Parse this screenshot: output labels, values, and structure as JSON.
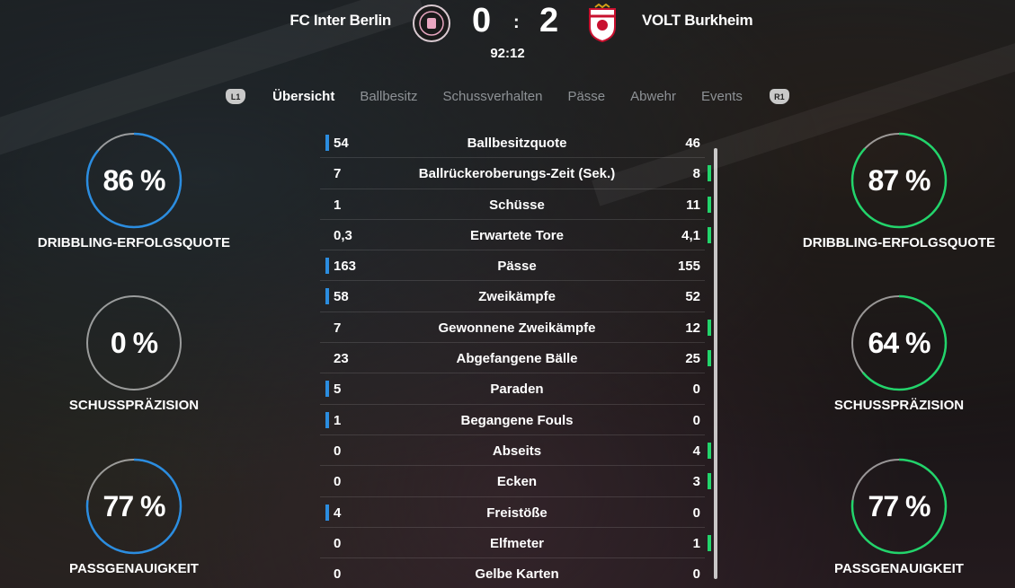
{
  "header": {
    "home_team": "FC Inter Berlin",
    "away_team": "VOLT Burkheim",
    "home_score": "0",
    "away_score": "2",
    "separator": ":",
    "clock": "92:12"
  },
  "tabs": {
    "left_bumper": "L1",
    "right_bumper": "R1",
    "items": [
      "Übersicht",
      "Ballbesitz",
      "Schussverhalten",
      "Pässe",
      "Abwehr",
      "Events"
    ],
    "active": "Übersicht"
  },
  "stats": [
    {
      "label": "Ballbesitzquote",
      "home": "54",
      "away": "46",
      "leader": "home"
    },
    {
      "label": "Ballrückeroberungs-Zeit (Sek.)",
      "home": "7",
      "away": "8",
      "leader": "away"
    },
    {
      "label": "Schüsse",
      "home": "1",
      "away": "11",
      "leader": "away"
    },
    {
      "label": "Erwartete Tore",
      "home": "0,3",
      "away": "4,1",
      "leader": "away"
    },
    {
      "label": "Pässe",
      "home": "163",
      "away": "155",
      "leader": "home"
    },
    {
      "label": "Zweikämpfe",
      "home": "58",
      "away": "52",
      "leader": "home"
    },
    {
      "label": "Gewonnene Zweikämpfe",
      "home": "7",
      "away": "12",
      "leader": "away"
    },
    {
      "label": "Abgefangene Bälle",
      "home": "23",
      "away": "25",
      "leader": "away"
    },
    {
      "label": "Paraden",
      "home": "5",
      "away": "0",
      "leader": "home"
    },
    {
      "label": "Begangene Fouls",
      "home": "1",
      "away": "0",
      "leader": "home"
    },
    {
      "label": "Abseits",
      "home": "0",
      "away": "4",
      "leader": "away"
    },
    {
      "label": "Ecken",
      "home": "0",
      "away": "3",
      "leader": "away"
    },
    {
      "label": "Freistöße",
      "home": "4",
      "away": "0",
      "leader": "home"
    },
    {
      "label": "Elfmeter",
      "home": "0",
      "away": "1",
      "leader": "away"
    },
    {
      "label": "Gelbe Karten",
      "home": "0",
      "away": "0",
      "leader": "none"
    }
  ],
  "gauges": {
    "home": [
      {
        "value": 86,
        "text": "86 %",
        "label": "DRIBBLING-ERFOLGSQUOTE"
      },
      {
        "value": 0,
        "text": "0 %",
        "label": "SCHUSSPRÄZISION"
      },
      {
        "value": 77,
        "text": "77 %",
        "label": "PASSGENAUIGKEIT"
      }
    ],
    "away": [
      {
        "value": 87,
        "text": "87 %",
        "label": "DRIBBLING-ERFOLGSQUOTE"
      },
      {
        "value": 64,
        "text": "64 %",
        "label": "SCHUSSPRÄZISION"
      },
      {
        "value": 77,
        "text": "77 %",
        "label": "PASSGENAUIGKEIT"
      }
    ]
  },
  "colors": {
    "home_accent": "#2b8de0",
    "away_accent": "#22d46b",
    "gauge_track": "rgba(255,255,255,0.55)"
  }
}
